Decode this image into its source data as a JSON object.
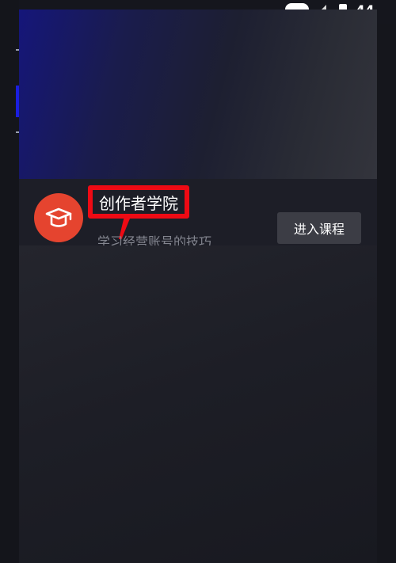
{
  "status_bar": {
    "time": "44",
    "icons": [
      "chat-bubble-icon",
      "signal-icon",
      "battery-icon"
    ]
  },
  "card": {
    "avatar_icon": "graduation-cap-icon",
    "title": "创作者学院",
    "subtitle": "学习经营账号的技巧",
    "enter_button_label": "进入课程"
  },
  "colors": {
    "avatar_bg": "#e5442f",
    "highlight_red": "#ee0a14",
    "button_bg": "#3c3d45",
    "banner_blue": "#15167a"
  }
}
